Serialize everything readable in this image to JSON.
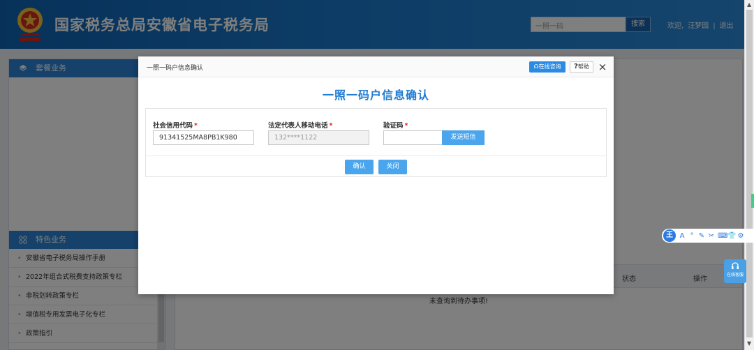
{
  "header": {
    "site_title": "国家税务总局安徽省电子税务局",
    "search_placeholder": "一照一码",
    "search_button": "搜索",
    "welcome": "欢迎,",
    "user_name": "汪梦园",
    "separator": "|",
    "logout": "退出"
  },
  "left_panel": {
    "package_title": "套餐业务",
    "special_title": "特色业务",
    "items": [
      {
        "label": "安徽省电子税务局操作手册"
      },
      {
        "label": "2022年组合式税费支持政策专栏"
      },
      {
        "label": "非税划转政策专栏"
      },
      {
        "label": "增值税专用发票电子化专栏"
      },
      {
        "label": "政策指引"
      }
    ]
  },
  "right_panel": {
    "col_status": "状态",
    "col_action": "操作",
    "empty_text": "未查询到待办事项!",
    "online_consult": "在线客服"
  },
  "float_toolbar": {
    "main_glyph": "王",
    "icons": [
      "A",
      "°",
      "✎",
      "✂",
      "⌨",
      "👕",
      "⚙"
    ]
  },
  "modal": {
    "title": "一照一码户信息确认",
    "consult_button": "在线咨询",
    "help_button": "帮助",
    "help_glyph": "?",
    "close_glyph": "×",
    "heading": "一照一码户信息确认",
    "fields": {
      "credit_code": {
        "label": "社会信用代码",
        "value": "91341525MA8PB1K980"
      },
      "phone": {
        "label": "法定代表人移动电话",
        "value": "132****1122"
      },
      "verify_code": {
        "label": "验证码",
        "value": ""
      }
    },
    "required_mark": "*",
    "send_sms_button": "发送短信",
    "confirm_button": "确认",
    "close_button": "关闭"
  },
  "colors": {
    "header_blue": "#0e63b3",
    "accent_blue": "#2b83d6",
    "button_blue": "#4aa5ec",
    "heading_blue": "#1e7bd1",
    "required_red": "#e02020"
  }
}
